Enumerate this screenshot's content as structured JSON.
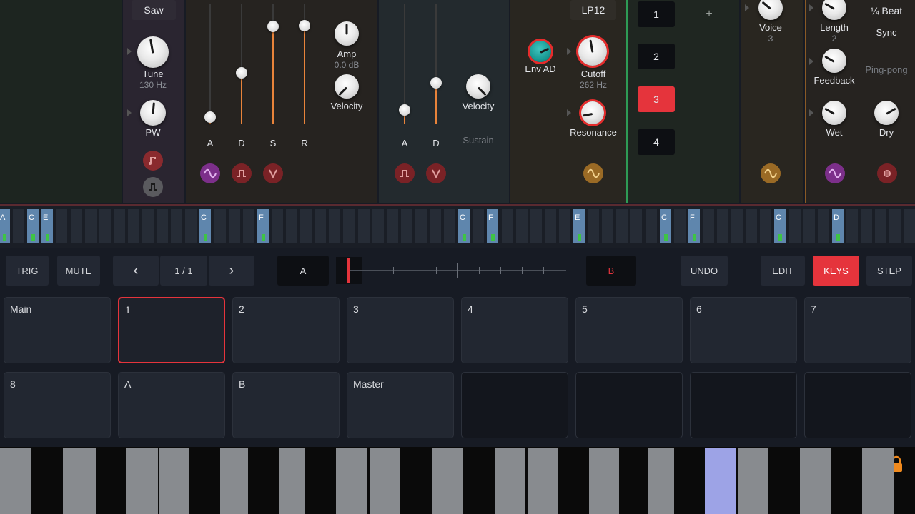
{
  "osc": {
    "wave_label": "Saw",
    "tune_label": "Tune",
    "tune_value": "130 Hz",
    "pw_label": "PW"
  },
  "env1": {
    "labels": [
      "A",
      "D",
      "S",
      "R"
    ],
    "amp_label": "Amp",
    "amp_value": "0.0 dB",
    "velocity_label": "Velocity"
  },
  "env2": {
    "labels": [
      "A",
      "D"
    ],
    "velocity_label": "Velocity",
    "sustain_label": "Sustain"
  },
  "filter": {
    "type_label": "LP12",
    "env_label": "Env AD",
    "cutoff_label": "Cutoff",
    "cutoff_value": "262 Hz",
    "resonance_label": "Resonance"
  },
  "layers": {
    "items": [
      "1",
      "2",
      "3",
      "4"
    ],
    "active": "3",
    "add_label": "+"
  },
  "voice": {
    "label": "Voice",
    "value": "3"
  },
  "delay": {
    "length_label": "Length",
    "length_value": "2",
    "feedback_label": "Feedback",
    "beat_label": "¼ Beat",
    "sync_label": "Sync",
    "pingpong_label": "Ping-pong",
    "wet_label": "Wet",
    "dry_label": "Dry"
  },
  "steps": {
    "notes": [
      "A",
      "C",
      "E",
      "C",
      "F",
      "C",
      "F",
      "E",
      "C",
      "F",
      "C",
      "D"
    ]
  },
  "controls": {
    "trig": "TRIG",
    "mute": "MUTE",
    "prev": "‹",
    "page": "1 / 1",
    "next": "›",
    "a_label": "A",
    "b_label": "B",
    "undo": "UNDO",
    "edit": "EDIT",
    "keys": "KEYS",
    "step": "STEP"
  },
  "pads": {
    "row1": [
      "Main",
      "1",
      "2",
      "3",
      "4",
      "5",
      "6",
      "7"
    ],
    "row2": [
      "8",
      "A",
      "B",
      "Master",
      "",
      "",
      "",
      ""
    ]
  },
  "colors": {
    "accent": "#e5343c",
    "led": "#3ec444",
    "step_on": "#5f86ad",
    "env_orange": "#e8833a",
    "key_pressed": "#9da3e6"
  }
}
